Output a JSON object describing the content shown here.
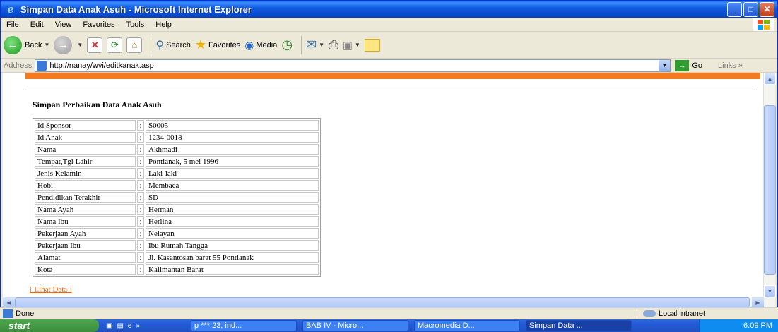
{
  "window": {
    "title": "Simpan Data Anak Asuh - Microsoft Internet Explorer"
  },
  "menu": [
    "File",
    "Edit",
    "View",
    "Favorites",
    "Tools",
    "Help"
  ],
  "toolbar": {
    "back": "Back",
    "search": "Search",
    "favorites": "Favorites",
    "media": "Media"
  },
  "address": {
    "label": "Address",
    "url": "http://nanay/wvi/editkanak.asp",
    "go": "Go",
    "links": "Links"
  },
  "page": {
    "heading": "Simpan Perbaikan Data Anak Asuh",
    "rows": [
      {
        "label": "Id Sponsor",
        "value": "S0005"
      },
      {
        "label": "Id Anak",
        "value": "1234-0018"
      },
      {
        "label": "Nama",
        "value": "Akhmadi"
      },
      {
        "label": "Tempat,Tgl Lahir",
        "value": "Pontianak, 5 mei 1996"
      },
      {
        "label": "Jenis Kelamin",
        "value": "Laki-laki"
      },
      {
        "label": "Hobi",
        "value": "Membaca"
      },
      {
        "label": "Pendidikan Terakhir",
        "value": "SD"
      },
      {
        "label": "Nama Ayah",
        "value": "Herman"
      },
      {
        "label": "Nama Ibu",
        "value": "Herlina"
      },
      {
        "label": "Pekerjaan Ayah",
        "value": "Nelayan"
      },
      {
        "label": "Pekerjaan Ibu",
        "value": "Ibu Rumah Tangga"
      },
      {
        "label": "Alamat",
        "value": "Jl. Kasantosan barat 55 Pontianak"
      },
      {
        "label": "Kota",
        "value": "Kalimantan Barat"
      }
    ],
    "separator": ":",
    "link": "[ Lihat Data ]",
    "accent_color": "#f47a20"
  },
  "status": {
    "text": "Done",
    "zone": "Local intranet"
  },
  "taskbar": {
    "start": "start",
    "tasks": [
      "p *** 23, ind...",
      "BAB IV - Micro...",
      "Macromedia D...",
      "Simpan Data ..."
    ],
    "clock": "6:09 PM"
  }
}
